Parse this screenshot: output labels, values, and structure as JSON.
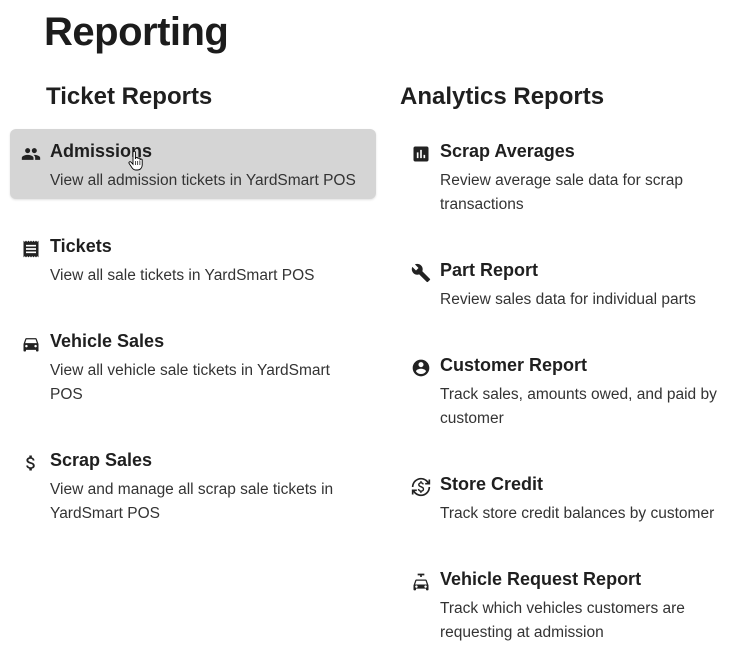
{
  "page": {
    "title": "Reporting"
  },
  "ticket_reports": {
    "heading": "Ticket Reports",
    "items": [
      {
        "title": "Admissions",
        "description": "View all admission tickets in YardSmart POS",
        "icon": "people-icon",
        "active": true
      },
      {
        "title": "Tickets",
        "description": "View all sale tickets in YardSmart POS",
        "icon": "receipt-icon",
        "active": false
      },
      {
        "title": "Vehicle Sales",
        "description": "View all vehicle sale tickets in YardSmart POS",
        "icon": "car-icon",
        "active": false
      },
      {
        "title": "Scrap Sales",
        "description": "View and manage all scrap sale tickets in YardSmart POS",
        "icon": "dollar-icon",
        "active": false
      }
    ]
  },
  "analytics_reports": {
    "heading": "Analytics Reports",
    "items": [
      {
        "title": "Scrap Averages",
        "description": "Review average sale data for scrap transactions",
        "icon": "bar-chart-icon"
      },
      {
        "title": "Part Report",
        "description": "Review sales data for individual parts",
        "icon": "wrench-icon"
      },
      {
        "title": "Customer Report",
        "description": "Track sales, amounts owed, and paid by customer",
        "icon": "account-circle-icon"
      },
      {
        "title": "Store Credit",
        "description": "Track store credit balances by customer",
        "icon": "currency-exchange-icon"
      },
      {
        "title": "Vehicle Request Report",
        "description": "Track which vehicles customers are requesting at admission",
        "icon": "car-request-icon"
      }
    ]
  },
  "colors": {
    "active_item_bg": "#d5d5d5",
    "text_primary": "#1f1f1f",
    "text_secondary": "#333333"
  }
}
